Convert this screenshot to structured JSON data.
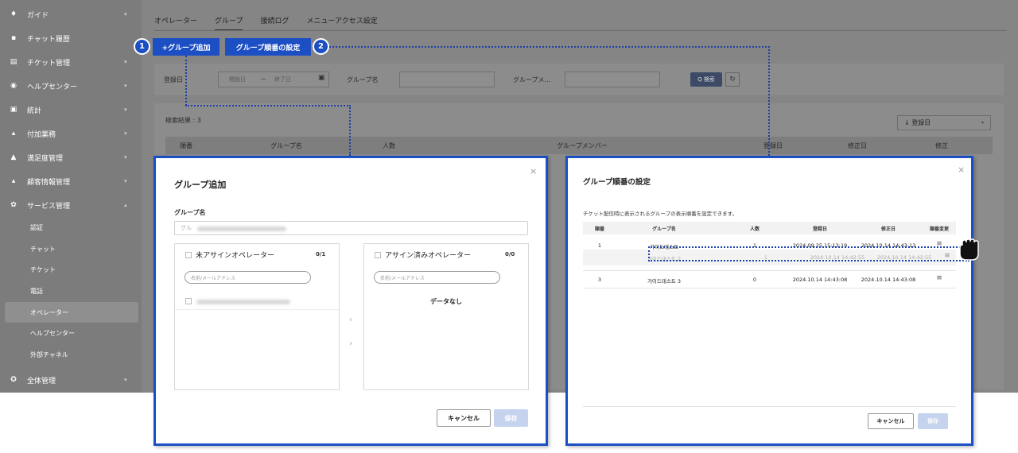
{
  "sidebar": {
    "items": [
      {
        "label": "ガイド",
        "icon": "bulb-icon",
        "glyph": "♦"
      },
      {
        "label": "チャット履歴",
        "icon": "chat-icon",
        "glyph": "▪"
      },
      {
        "label": "チケット管理",
        "icon": "ticket-icon",
        "glyph": "▤"
      },
      {
        "label": "ヘルプセンター",
        "icon": "help-icon",
        "glyph": "◉"
      },
      {
        "label": "統計",
        "icon": "stats-icon",
        "glyph": "▣"
      },
      {
        "label": "付加業務",
        "icon": "task-icon",
        "glyph": "▴"
      },
      {
        "label": "満足度管理",
        "icon": "thumb-icon",
        "glyph": "▲"
      },
      {
        "label": "顧客情報管理",
        "icon": "customer-icon",
        "glyph": "▴"
      },
      {
        "label": "サービス管理",
        "icon": "gear-icon",
        "glyph": "✿"
      }
    ],
    "sub_items": [
      "認証",
      "チャット",
      "チケット",
      "電話",
      "オペレーター",
      "ヘルプセンター",
      "外部チャネル"
    ],
    "bottom_item": {
      "label": "全体管理",
      "icon": "settings-icon",
      "glyph": "✪"
    }
  },
  "tabs": [
    "オペレーター",
    "グループ",
    "接続ログ",
    "メニューアクセス設定"
  ],
  "callouts": {
    "add_group": "+グループ追加",
    "order_settings": "グループ順番の設定",
    "marker1": "1",
    "marker2": "2"
  },
  "filter": {
    "date_label": "登録日",
    "start_placeholder": "開始日",
    "tilde": "~",
    "end_placeholder": "終了日",
    "group_name_label": "グループ名",
    "group_member_label": "グループメ…",
    "search_button": "Q 検索",
    "reset_glyph": "↻"
  },
  "results": {
    "count_label": "検索結果 : 3",
    "sort_label": "↓ 登録日",
    "columns": [
      "順番",
      "グループ名",
      "人数",
      "グループメンバー",
      "登録日",
      "修正日",
      "修正"
    ]
  },
  "add_modal": {
    "title": "グループ追加",
    "close": "×",
    "group_name_label": "グループ名",
    "group_name_placeholder": "グル",
    "unassigned_title": "未アサインオペレーター",
    "unassigned_count": "0/1",
    "assigned_title": "アサイン済みオペレーター",
    "assigned_count": "0/0",
    "search_placeholder": "名前/メールアドレス",
    "no_data": "データなし",
    "arrow_left": "‹",
    "arrow_right": "›",
    "cancel": "キャンセル",
    "save": "保存"
  },
  "order_modal": {
    "title": "グループ順番の設定",
    "close": "×",
    "description": "チケット配信時に表示されるグループの表示順番を設定できます。",
    "columns": [
      "順番",
      "グループ名",
      "人数",
      "登録日",
      "修正日",
      "順番変更"
    ],
    "rows": [
      {
        "order": "1",
        "name": "가이드테스트",
        "count": "1",
        "created": "2024.09.25 15:13:19",
        "modified": "2024.10.14 14:43:13",
        "handle": "≡"
      },
      {
        "order": "",
        "name": "가이드테스트 2",
        "count": "1",
        "created": "2024.10.14 14:42:55",
        "modified": "2024.10.14 14:42:55",
        "handle": "≡"
      },
      {
        "order": "3",
        "name": "가이드테스트 3",
        "count": "0",
        "created": "2024.10.14 14:43:08",
        "modified": "2024.10.14 14:43:08",
        "handle": "≡"
      }
    ],
    "cancel": "キャンセル",
    "save": "保存"
  },
  "colors": {
    "accent": "#1d4fc4",
    "dim_overlay": "#858585"
  }
}
